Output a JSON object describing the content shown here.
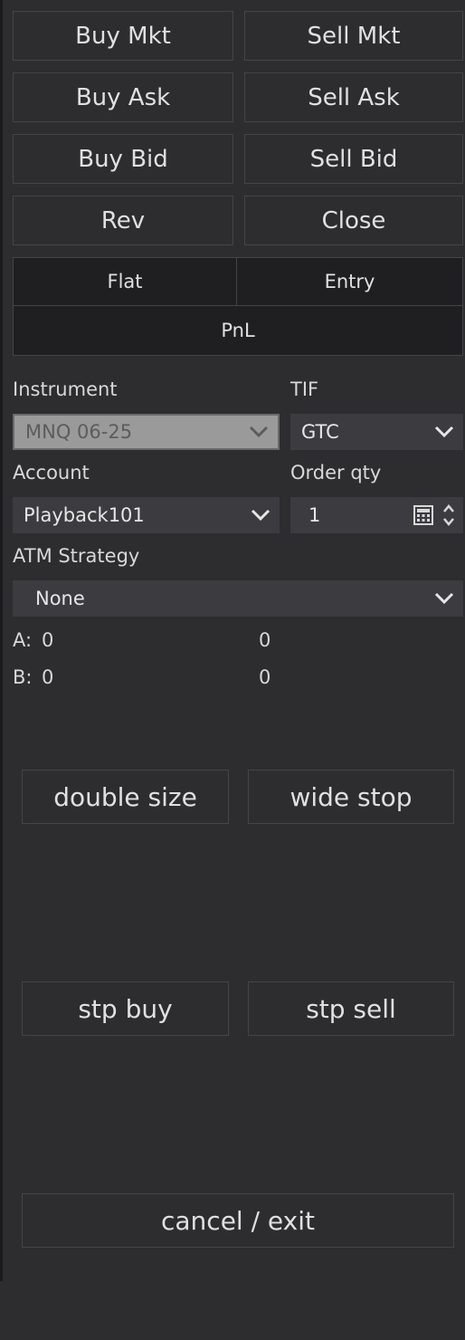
{
  "order_buttons": {
    "buy_mkt": "Buy Mkt",
    "sell_mkt": "Sell Mkt",
    "buy_ask": "Buy Ask",
    "sell_ask": "Sell Ask",
    "buy_bid": "Buy Bid",
    "sell_bid": "Sell Bid",
    "rev": "Rev",
    "close": "Close"
  },
  "position": {
    "flat": "Flat",
    "entry": "Entry",
    "pnl": "PnL"
  },
  "fields": {
    "instrument_label": "Instrument",
    "instrument_value": "MNQ 06-25",
    "tif_label": "TIF",
    "tif_value": "GTC",
    "account_label": "Account",
    "account_value": "Playback101",
    "order_qty_label": "Order qty",
    "order_qty_value": "1",
    "atm_label": "ATM Strategy",
    "atm_value": "None"
  },
  "quotes": {
    "ask_label": "A:",
    "ask_size": "0",
    "ask_price": "0",
    "bid_label": "B:",
    "bid_size": "0",
    "bid_price": "0"
  },
  "custom_buttons": {
    "double_size": "double size",
    "wide_stop": "wide stop",
    "stp_buy": "stp buy",
    "stp_sell": "stp sell",
    "cancel_exit": "cancel / exit"
  },
  "icons": {
    "dropdown": "chevron-down-icon",
    "calculator": "calculator-icon",
    "spinner": "spinner-icon"
  }
}
